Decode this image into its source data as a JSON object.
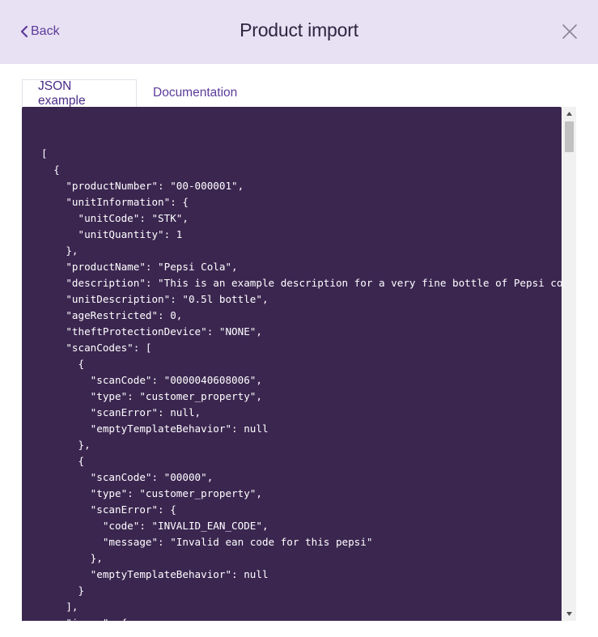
{
  "header": {
    "back_label": "Back",
    "title": "Product import"
  },
  "tabs": [
    {
      "label": "JSON example",
      "active": true
    },
    {
      "label": "Documentation",
      "active": false
    }
  ],
  "code": {
    "lines": [
      "[",
      "  {",
      "    \"productNumber\": \"00-000001\",",
      "    \"unitInformation\": {",
      "      \"unitCode\": \"STK\",",
      "      \"unitQuantity\": 1",
      "    },",
      "    \"productName\": \"Pepsi Cola\",",
      "    \"description\": \"This is an example description for a very fine bottle of Pepsi cola\",",
      "    \"unitDescription\": \"0.5l bottle\",",
      "    \"ageRestricted\": 0,",
      "    \"theftProtectionDevice\": \"NONE\",",
      "    \"scanCodes\": [",
      "      {",
      "        \"scanCode\": \"0000040608006\",",
      "        \"type\": \"customer_property\",",
      "        \"scanError\": null,",
      "        \"emptyTemplateBehavior\": null",
      "      },",
      "      {",
      "        \"scanCode\": \"00000\",",
      "        \"type\": \"customer_property\",",
      "        \"scanError\": {",
      "          \"code\": \"INVALID_EAN_CODE\",",
      "          \"message\": \"Invalid ean code for this pepsi\"",
      "        },",
      "        \"emptyTemplateBehavior\": null",
      "      }",
      "    ],",
      "    \"image\": {"
    ]
  },
  "colors": {
    "header_bg": "#e8e0f3",
    "accent": "#5b3b9a",
    "code_bg": "#3b2650"
  },
  "icons": {
    "back": "chevron-left-icon",
    "close": "close-icon"
  }
}
